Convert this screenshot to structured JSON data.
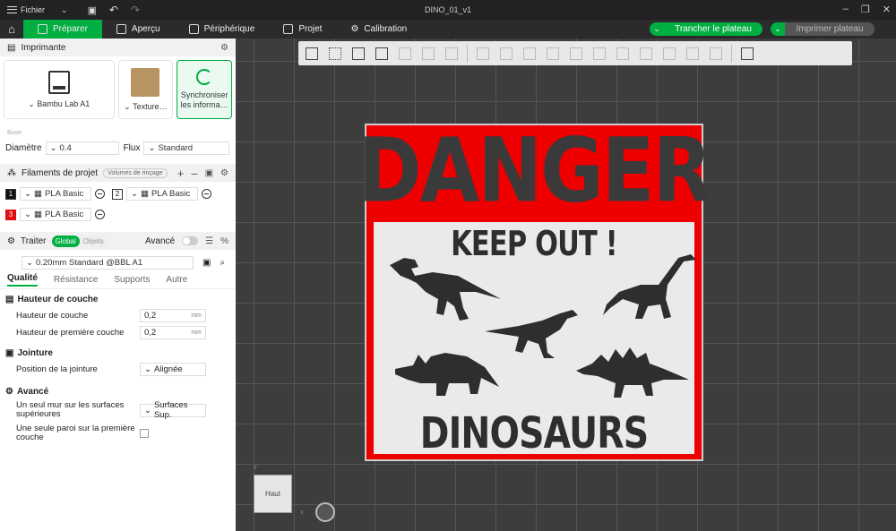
{
  "titlebar": {
    "menu_label": "Fichier",
    "window_title": "DINO_01_v1"
  },
  "tabs": [
    {
      "label": "Préparer",
      "active": true
    },
    {
      "label": "Aperçu"
    },
    {
      "label": "Périphérique"
    },
    {
      "label": "Projet"
    },
    {
      "label": "Calibration"
    }
  ],
  "actions": {
    "slice": "Trancher le plateau",
    "print": "Imprimer plateau"
  },
  "printer": {
    "section": "Imprimante",
    "model": "Bambu Lab A1",
    "plate": "Texture…",
    "sync": "Synchroniser les informa…",
    "nozzle_label": "Buse",
    "diameter_label": "Diamètre",
    "diameter": "0.4",
    "flow_label": "Flux",
    "flow": "Standard"
  },
  "filaments": {
    "section": "Filaments de projet",
    "flush_btn": "Volumes de rinçage",
    "items": [
      {
        "num": "1",
        "name": "PLA Basic",
        "color": "#111111"
      },
      {
        "num": "2",
        "name": "PLA Basic",
        "color": "#ffffff"
      },
      {
        "num": "3",
        "name": "PLA Basic",
        "color": "#e01010"
      }
    ]
  },
  "process": {
    "section": "Traiter",
    "toggle_global": "Global",
    "toggle_objects": "Objets",
    "advanced": "Avancé",
    "profile": "0.20mm Standard @BBL A1",
    "subtabs": [
      "Qualité",
      "Résistance",
      "Supports",
      "Autre"
    ],
    "groups": {
      "layer": "Hauteur de couche",
      "layer_height_label": "Hauteur de couche",
      "layer_height": "0,2",
      "first_layer_label": "Hauteur de première couche",
      "first_layer": "0,2",
      "unit": "mm",
      "seam": "Jointure",
      "seam_pos_label": "Position de la jointure",
      "seam_pos": "Alignée",
      "adv": "Avancé",
      "single_wall_label": "Un seul mur sur les surfaces supérieures",
      "single_wall": "Surfaces Sup.",
      "single_bottom_label": "Une seule paroi sur la première couche"
    }
  },
  "sign": {
    "title": "DANGER",
    "subtitle": "KEEP OUT !",
    "footer": "DINOSAURS"
  },
  "viewcube": {
    "label": "Haut",
    "x": "x",
    "y": "y"
  },
  "colors": {
    "accent": "#00ae42",
    "sign_red": "#e00000"
  }
}
